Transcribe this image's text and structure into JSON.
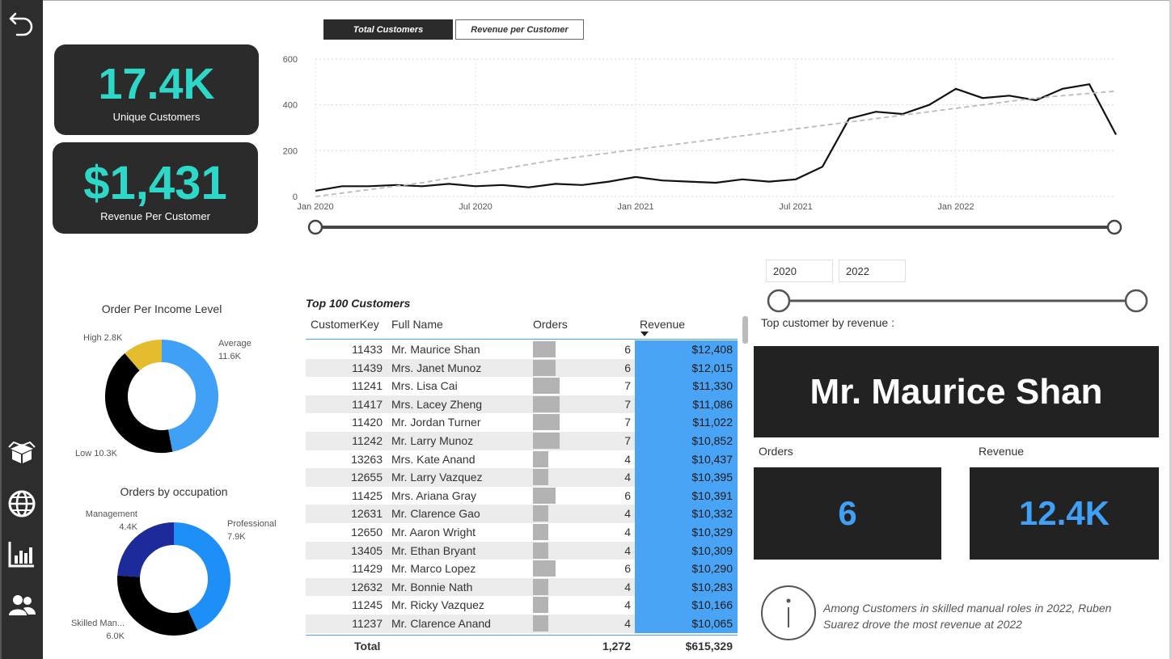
{
  "nav": {
    "back_icon": "back-arrow-icon",
    "items": [
      {
        "icon": "box-icon"
      },
      {
        "icon": "globe-icon"
      },
      {
        "icon": "bar-chart-icon"
      },
      {
        "icon": "people-icon"
      }
    ]
  },
  "kpis": {
    "unique_customers": {
      "value": "17.4K",
      "label": "Unique Customers"
    },
    "revenue_per_customer": {
      "value": "$1,431",
      "label": "Revenue Per Customer"
    }
  },
  "line_chart": {
    "tabs": [
      {
        "label": "Total Customers",
        "active": true
      },
      {
        "label": "Revenue per Customer",
        "active": false
      }
    ],
    "y_ticks": [
      "600",
      "400",
      "200",
      "0"
    ],
    "x_ticks": [
      "Jan 2020",
      "Jul 2020",
      "Jan 2021",
      "Jul 2021",
      "Jan 2022"
    ]
  },
  "chart_data": [
    {
      "type": "line",
      "ylim": [
        0,
        600
      ],
      "x": [
        "2020-01",
        "2020-02",
        "2020-03",
        "2020-04",
        "2020-05",
        "2020-06",
        "2020-07",
        "2020-08",
        "2020-09",
        "2020-10",
        "2020-11",
        "2020-12",
        "2021-01",
        "2021-02",
        "2021-03",
        "2021-04",
        "2021-05",
        "2021-06",
        "2021-07",
        "2021-08",
        "2021-09",
        "2021-10",
        "2021-11",
        "2021-12",
        "2022-01",
        "2022-02",
        "2022-03",
        "2022-04",
        "2022-05",
        "2022-06",
        "2022-07"
      ],
      "series": [
        {
          "values": [
            25,
            45,
            45,
            50,
            45,
            55,
            45,
            50,
            40,
            55,
            50,
            65,
            85,
            70,
            65,
            60,
            75,
            65,
            75,
            130,
            340,
            370,
            360,
            400,
            470,
            430,
            440,
            420,
            470,
            490,
            270
          ]
        },
        {
          "values": [
            0,
            15,
            30,
            45,
            60,
            80,
            100,
            120,
            140,
            160,
            175,
            190,
            205,
            220,
            235,
            250,
            265,
            280,
            295,
            310,
            325,
            340,
            355,
            370,
            385,
            400,
            415,
            430,
            440,
            450,
            460
          ]
        }
      ]
    },
    {
      "type": "pie",
      "title": "Order Per Income Level",
      "categories": [
        "Average",
        "Low",
        "High"
      ],
      "values": [
        11.6,
        10.3,
        2.8
      ],
      "colors": [
        "#3fa0f5",
        "#000000",
        "#e3bd2e"
      ]
    },
    {
      "type": "pie",
      "title": "Orders by occupation",
      "categories": [
        "Professional",
        "Skilled Man...",
        "Management"
      ],
      "values": [
        7.9,
        6.0,
        4.4
      ],
      "colors": [
        "#1e8ff7",
        "#000000",
        "#1c2a9a"
      ]
    }
  ],
  "donut_labels": {
    "income": [
      {
        "name": "Average",
        "value": "11.6K"
      },
      {
        "text": "Low 10.3K"
      },
      {
        "text": "High 2.8K"
      }
    ],
    "occupation": [
      {
        "name": "Professional",
        "value": "7.9K"
      },
      {
        "name": "Skilled Man...",
        "value": "6.0K"
      },
      {
        "name": "Management",
        "value": "4.4K"
      }
    ]
  },
  "table": {
    "title": "Top 100 Customers",
    "columns": [
      "CustomerKey",
      "Full Name",
      "Orders",
      "Revenue"
    ],
    "rows": [
      {
        "key": "11433",
        "name": "Mr. Maurice Shan",
        "orders": 6,
        "revenue": "$12,408"
      },
      {
        "key": "11439",
        "name": "Mrs. Janet Munoz",
        "orders": 6,
        "revenue": "$12,015"
      },
      {
        "key": "11241",
        "name": "Mrs. Lisa Cai",
        "orders": 7,
        "revenue": "$11,330"
      },
      {
        "key": "11417",
        "name": "Mrs. Lacey Zheng",
        "orders": 7,
        "revenue": "$11,086"
      },
      {
        "key": "11420",
        "name": "Mr. Jordan Turner",
        "orders": 7,
        "revenue": "$11,022"
      },
      {
        "key": "11242",
        "name": "Mr. Larry Munoz",
        "orders": 7,
        "revenue": "$10,852"
      },
      {
        "key": "13263",
        "name": "Mrs. Kate Anand",
        "orders": 4,
        "revenue": "$10,437"
      },
      {
        "key": "12655",
        "name": "Mr. Larry Vazquez",
        "orders": 4,
        "revenue": "$10,395"
      },
      {
        "key": "11425",
        "name": "Mrs. Ariana Gray",
        "orders": 6,
        "revenue": "$10,391"
      },
      {
        "key": "12631",
        "name": "Mr. Clarence Gao",
        "orders": 4,
        "revenue": "$10,332"
      },
      {
        "key": "12650",
        "name": "Mr. Aaron Wright",
        "orders": 4,
        "revenue": "$10,329"
      },
      {
        "key": "13405",
        "name": "Mr. Ethan Bryant",
        "orders": 4,
        "revenue": "$10,309"
      },
      {
        "key": "11429",
        "name": "Mr. Marco Lopez",
        "orders": 6,
        "revenue": "$10,290"
      },
      {
        "key": "12632",
        "name": "Mr. Bonnie Nath",
        "orders": 4,
        "revenue": "$10,283"
      },
      {
        "key": "11245",
        "name": "Mr. Ricky Vazquez",
        "orders": 4,
        "revenue": "$10,166"
      },
      {
        "key": "11237",
        "name": "Mr. Clarence Anand",
        "orders": 4,
        "revenue": "$10,065"
      }
    ],
    "total": {
      "label": "Total",
      "orders": "1,272",
      "revenue": "$615,329"
    }
  },
  "filter": {
    "year_from": "2020",
    "year_to": "2022"
  },
  "top_customer": {
    "label": "Top customer by revenue :",
    "name": "Mr. Maurice Shan",
    "orders_label": "Orders",
    "orders_value": "6",
    "revenue_label": "Revenue",
    "revenue_value": "12.4K"
  },
  "insight": {
    "icon": "info-icon",
    "text": "Among Customers in skilled manual roles in 2022, Ruben Suarez drove the most revenue at 2022"
  },
  "colors": {
    "accent_teal": "#2ed8c8",
    "accent_blue": "#3fa0f5",
    "dark": "#222222"
  }
}
